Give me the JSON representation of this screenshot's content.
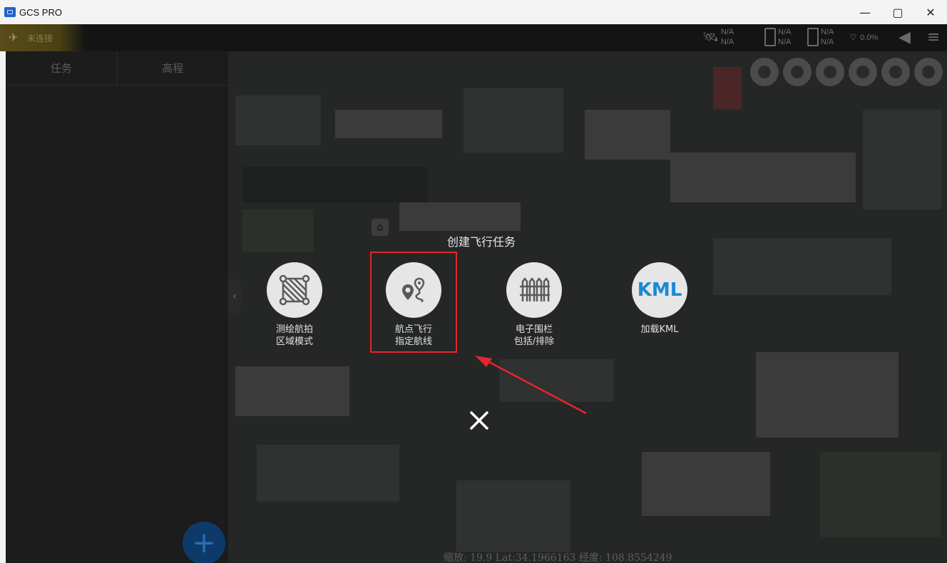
{
  "window": {
    "title": "GCS PRO",
    "minimize": "—",
    "restore": "▢",
    "close": "✕"
  },
  "topbar": {
    "connection_status": "未连接",
    "stats": [
      {
        "a": "N/A",
        "b": "N/A"
      },
      {
        "a": "N/A",
        "b": "N/A"
      },
      {
        "a": "N/A",
        "b": "N/A"
      }
    ],
    "signal_percent": "0.0%"
  },
  "left_panel": {
    "tabs": [
      {
        "label": "任务"
      },
      {
        "label": "高程"
      }
    ],
    "add_button": "+"
  },
  "dialog": {
    "title": "创建飞行任务",
    "options": [
      {
        "line1": "测绘航拍",
        "line2": "区域模式",
        "icon": "survey-grid-icon"
      },
      {
        "line1": "航点飞行",
        "line2": "指定航线",
        "icon": "waypoint-route-icon"
      },
      {
        "line1": "电子围栏",
        "line2": "包括/排除",
        "icon": "fence-icon"
      },
      {
        "line1": "加载KML",
        "line2": "",
        "icon": "kml-icon",
        "icon_text": "KML"
      }
    ],
    "close": "✕"
  },
  "status": {
    "coordinates": "缩放: 19.9  Lat:34.1966163   经度: 108.8554249"
  },
  "colors": {
    "highlight": "#e3262b",
    "kml_blue": "#1a8ad4",
    "add_button": "#0e3a6a"
  }
}
